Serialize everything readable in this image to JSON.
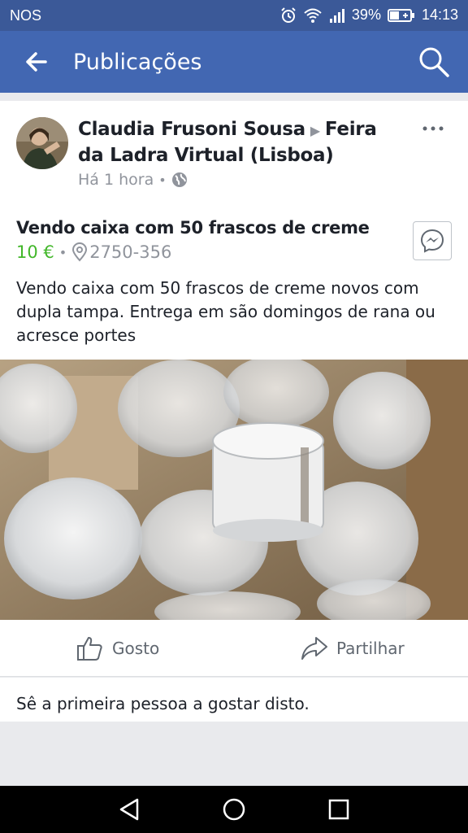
{
  "status": {
    "carrier": "NOS",
    "battery": "39%",
    "time": "14:13"
  },
  "appbar": {
    "title": "Publicações"
  },
  "post": {
    "author": "Claudia Frusoni Sousa",
    "group": "Feira da Ladra Virtual (Lisboa)",
    "time": "Há 1 hora",
    "item_title": "Vendo caixa com 50 frascos de creme",
    "price": "10 €",
    "location": "2750-356",
    "description": "Vendo caixa com 50 frascos de creme novos com dupla tampa. Entrega em são domingos de rana ou acresce portes"
  },
  "actions": {
    "like": "Gosto",
    "share": "Partilhar"
  },
  "likes_text": "Sê a primeira pessoa a gostar disto.",
  "colors": {
    "statusbar": "#3b5998",
    "appbar": "#4267b2",
    "price": "#42b72a"
  },
  "icons": [
    "back-arrow-icon",
    "search-icon",
    "more-icon",
    "globe-icon",
    "location-pin-icon",
    "messenger-icon",
    "thumbs-up-icon",
    "share-arrow-icon",
    "nav-back-icon",
    "nav-home-icon",
    "nav-recents-icon"
  ]
}
